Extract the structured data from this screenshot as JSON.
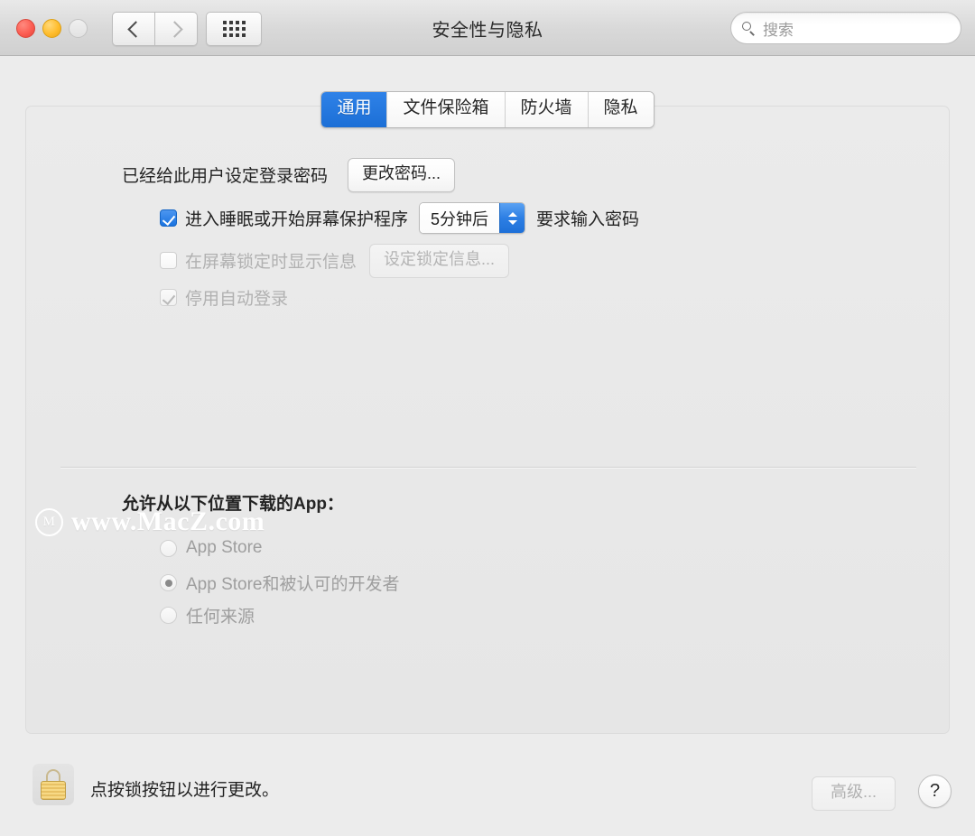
{
  "window": {
    "title": "安全性与隐私",
    "traffic_lights": [
      "close",
      "minimize",
      "zoom"
    ]
  },
  "toolbar": {
    "back_icon": "chevron-left-icon",
    "forward_icon": "chevron-right-icon",
    "grid_icon": "grid-dots-icon",
    "search": {
      "placeholder": "搜索",
      "value": "",
      "icon": "search-icon"
    }
  },
  "tabs": [
    {
      "label": "通用",
      "active": true
    },
    {
      "label": "文件保险箱",
      "active": false
    },
    {
      "label": "防火墙",
      "active": false
    },
    {
      "label": "隐私",
      "active": false
    }
  ],
  "general": {
    "password_status": "已经给此用户设定登录密码",
    "change_password_button": "更改密码...",
    "require_password": {
      "prefix": "进入睡眠或开始屏幕保护程序",
      "delay_value": "5分钟后",
      "suffix": "要求输入密码",
      "checked": true,
      "enabled": true
    },
    "show_message": {
      "label": "在屏幕锁定时显示信息",
      "button": "设定锁定信息...",
      "checked": false,
      "enabled": false
    },
    "disable_auto_login": {
      "label": "停用自动登录",
      "checked": true,
      "enabled": false
    }
  },
  "downloads": {
    "heading": "允许从以下位置下载的App：",
    "options": [
      {
        "label": "App Store",
        "selected": false
      },
      {
        "label": "App Store和被认可的开发者",
        "selected": true
      },
      {
        "label": "任何来源",
        "selected": false
      }
    ]
  },
  "watermark": {
    "logo_letter": "M",
    "text": "www.MacZ.com"
  },
  "footer": {
    "lock_icon": "padlock-closed-icon",
    "lock_message": "点按锁按钮以进行更改。",
    "advanced_button": "高级...",
    "help_button": "?"
  },
  "colors": {
    "accent": "#1c6fd6",
    "window_bg": "#ececec",
    "panel_bg": "#e9e9e9",
    "traffic_close": "#fc5d52",
    "traffic_min": "#ffbd2d",
    "lock_gold": "#e8c164"
  }
}
